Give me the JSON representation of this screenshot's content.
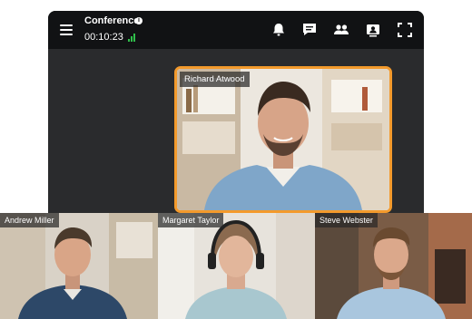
{
  "header": {
    "title": "Conference",
    "info_icon": "info-icon",
    "timer": "00:10:23",
    "signal_icon": "signal-strength-icon",
    "actions": [
      "bell-icon",
      "chat-icon",
      "participants-icon",
      "screen-share-icon",
      "fullscreen-icon"
    ]
  },
  "main_speaker": {
    "name": "Richard Atwood",
    "highlight_color": "#f39a2c"
  },
  "participants": [
    {
      "name": "Andrew Miller"
    },
    {
      "name": "Margaret Taylor"
    },
    {
      "name": "Steve Webster"
    }
  ],
  "colors": {
    "topbar": "#111214",
    "background": "#2a2b2d",
    "signal": "#2fbf4a"
  }
}
